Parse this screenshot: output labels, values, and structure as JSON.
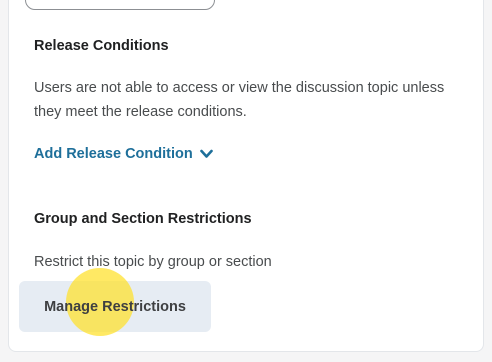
{
  "release_conditions": {
    "heading": "Release Conditions",
    "description": "Users are not able to access or view the discussion topic unless they meet the release conditions.",
    "add_link_label": "Add Release Condition",
    "link_color": "#1e6f9a",
    "link_icon": "chevron-down-icon"
  },
  "group_restrictions": {
    "heading": "Group and Section Restrictions",
    "description": "Restrict this topic by group or section",
    "manage_button_label": "Manage Restrictions",
    "button_background": "#e6ecf3"
  },
  "click_indicator": {
    "color": "#ffe128"
  }
}
